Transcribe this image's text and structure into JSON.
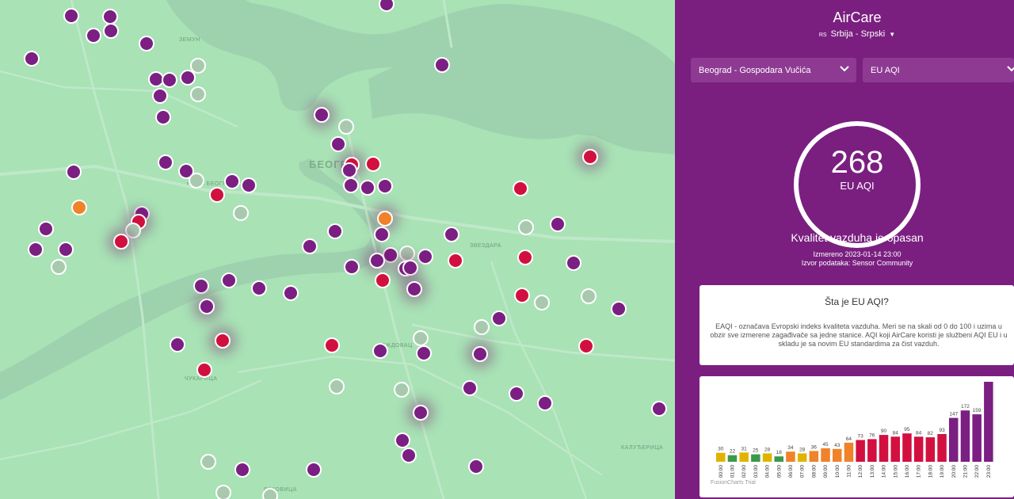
{
  "app": {
    "title": "AirCare",
    "language_label": "Srbija - Srpski",
    "flag_code": "RS"
  },
  "filters": {
    "station": "Beograd - Gospodara Vučića",
    "index": "EU AQI"
  },
  "reading": {
    "value": "268",
    "unit": "EU AQI",
    "quality": "Kvalitet vazduha je opasan",
    "measured": "Izmereno 2023-01-14 23:00",
    "source": "Izvor podataka: Sensor Community"
  },
  "info_card": {
    "title": "Šta je EU AQI?",
    "body": "EAQI - označava Evropski indeks kvaliteta vazduha. Meri se na skali od 0 do 100 i uzima u obzir sve izmerene zagađivače sa jedne stanice. AQI koji AirCare koristi je službeni AQI EU i u skladu je sa novim EU standardima za čist vazduh."
  },
  "map": {
    "labels": [
      "ЗЕМУН",
      "БЕОГР",
      "ЗВЕЗДАРА",
      "ЧУКАРИЦА",
      "ВОЖДОВАЦ",
      "РАКОВИЦА",
      "КАЛУЂЕРИЦА",
      "НОВИ БЕОГРАД"
    ],
    "colors": {
      "purple": "#7b1f83",
      "red": "#d2103f",
      "orange": "#f0822a",
      "grey": "#a9c9ae"
    }
  },
  "chart_data": {
    "type": "bar",
    "categories": [
      "00:00",
      "01:00",
      "02:00",
      "03:00",
      "04:00",
      "05:00",
      "06:00",
      "07:00",
      "08:00",
      "09:00",
      "10:00",
      "11:00",
      "12:00",
      "13:00",
      "14:00",
      "15:00",
      "16:00",
      "17:00",
      "18:00",
      "19:00",
      "20:00",
      "21:00",
      "22:00",
      "23:00"
    ],
    "values": [
      30,
      22,
      31,
      25,
      28,
      18,
      34,
      28,
      36,
      45,
      43,
      64,
      73,
      76,
      90,
      84,
      95,
      84,
      82,
      93,
      147,
      172,
      159,
      268
    ],
    "colors": [
      "#e0b300",
      "#3a9a4a",
      "#e0b300",
      "#3a9a4a",
      "#e0b300",
      "#3a9a4a",
      "#f0822a",
      "#e0b300",
      "#f0822a",
      "#f0822a",
      "#f0822a",
      "#f0822a",
      "#d2103f",
      "#d2103f",
      "#d2103f",
      "#d2103f",
      "#d2103f",
      "#d2103f",
      "#d2103f",
      "#d2103f",
      "#7b1f83",
      "#7b1f83",
      "#7b1f83",
      "#7b1f83"
    ],
    "ylim": [
      0,
      268
    ],
    "watermark": "FusionCharts Trial"
  }
}
